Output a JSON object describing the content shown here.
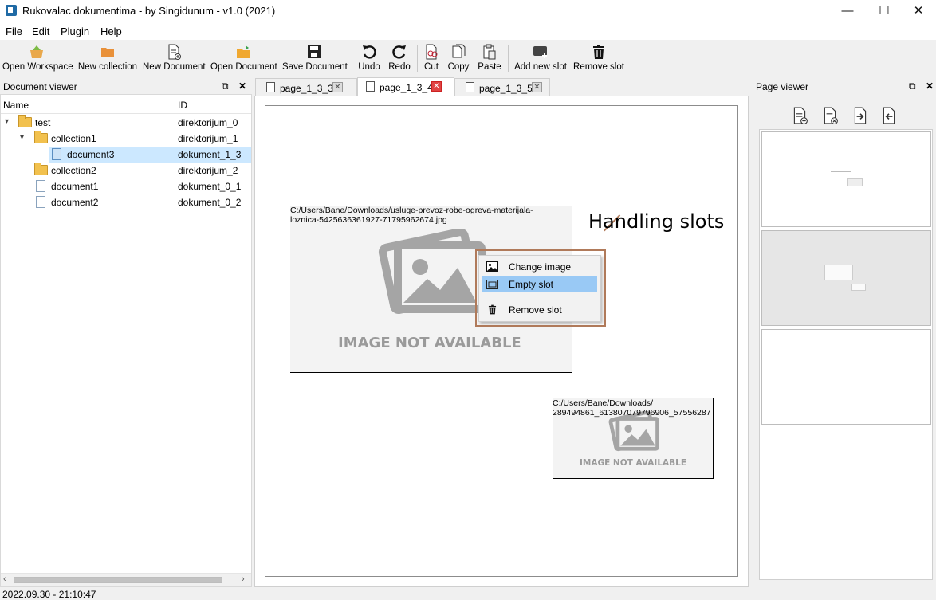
{
  "window": {
    "title": "Rukovalac dokumentima - by Singidunum - v1.0 (2021)",
    "minimize": "—",
    "maximize": "☐",
    "close": "✕"
  },
  "menu": [
    "File",
    "Edit",
    "Plugin",
    "Help"
  ],
  "toolbar": {
    "open_workspace": "Open Workspace",
    "new_collection": "New collection",
    "new_document": "New Document",
    "open_document": "Open Document",
    "save_document": "Save Document",
    "undo": "Undo",
    "redo": "Redo",
    "cut": "Cut",
    "copy": "Copy",
    "paste": "Paste",
    "add_new_slot": "Add new slot",
    "remove_slot": "Remove slot"
  },
  "document_viewer": {
    "title": "Document viewer",
    "col_name": "Name",
    "col_id": "ID",
    "rows": [
      {
        "name": "test",
        "id": "direktorijum_0"
      },
      {
        "name": "collection1",
        "id": "direktorijum_1"
      },
      {
        "name": "document3",
        "id": "dokument_1_3"
      },
      {
        "name": "collection2",
        "id": "direktorijum_2"
      },
      {
        "name": "document1",
        "id": "dokument_0_1"
      },
      {
        "name": "document2",
        "id": "dokument_0_2"
      }
    ]
  },
  "tabs": [
    {
      "label": "page_1_3_3"
    },
    {
      "label": "page_1_3_4"
    },
    {
      "label": "page_1_3_5"
    }
  ],
  "slots": [
    {
      "path": "C:/Users/Bane/Downloads/usluge-prevoz-robe-ogreva-materijala-\nloznica-5425636361927-71795962674.jpg",
      "placeholder": "IMAGE NOT AVAILABLE"
    },
    {
      "path": "C:/Users/Bane/Downloads/\n289494861_613807079796906_57556287",
      "placeholder": "IMAGE NOT AVAILABLE"
    }
  ],
  "context_menu": {
    "change_image": "Change image",
    "empty_slot": "Empty slot",
    "remove_slot": "Remove slot"
  },
  "annotation": "Handling slots",
  "page_viewer": {
    "title": "Page viewer"
  },
  "status": "2022.09.30 - 21:10:47"
}
